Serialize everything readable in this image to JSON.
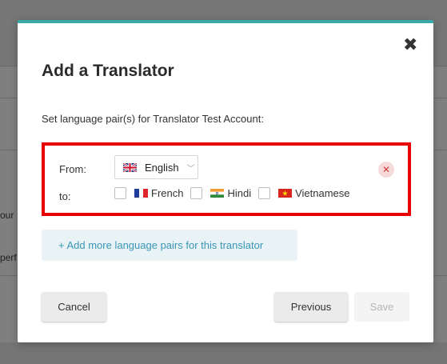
{
  "background": {
    "fragments": [
      "our",
      "perf"
    ]
  },
  "modal": {
    "title": "Add a Translator",
    "subtitle": "Set language pair(s) for Translator Test Account:",
    "close_icon": "close-icon",
    "accent_color": "#39aaa9",
    "highlight_color": "#e60000",
    "pair": {
      "from_label": "From:",
      "to_label": "to:",
      "source_language": {
        "flag": "uk-flag-icon",
        "label": "English"
      },
      "target_languages": [
        {
          "flag": "france-flag-icon",
          "label": "French",
          "checked": false
        },
        {
          "flag": "india-flag-icon",
          "label": "Hindi",
          "checked": false
        },
        {
          "flag": "vietnam-flag-icon",
          "label": "Vietnamese",
          "checked": false
        }
      ]
    },
    "add_more_label": "+ Add more language pairs for this translator",
    "buttons": {
      "cancel": "Cancel",
      "previous": "Previous",
      "save": "Save"
    }
  }
}
